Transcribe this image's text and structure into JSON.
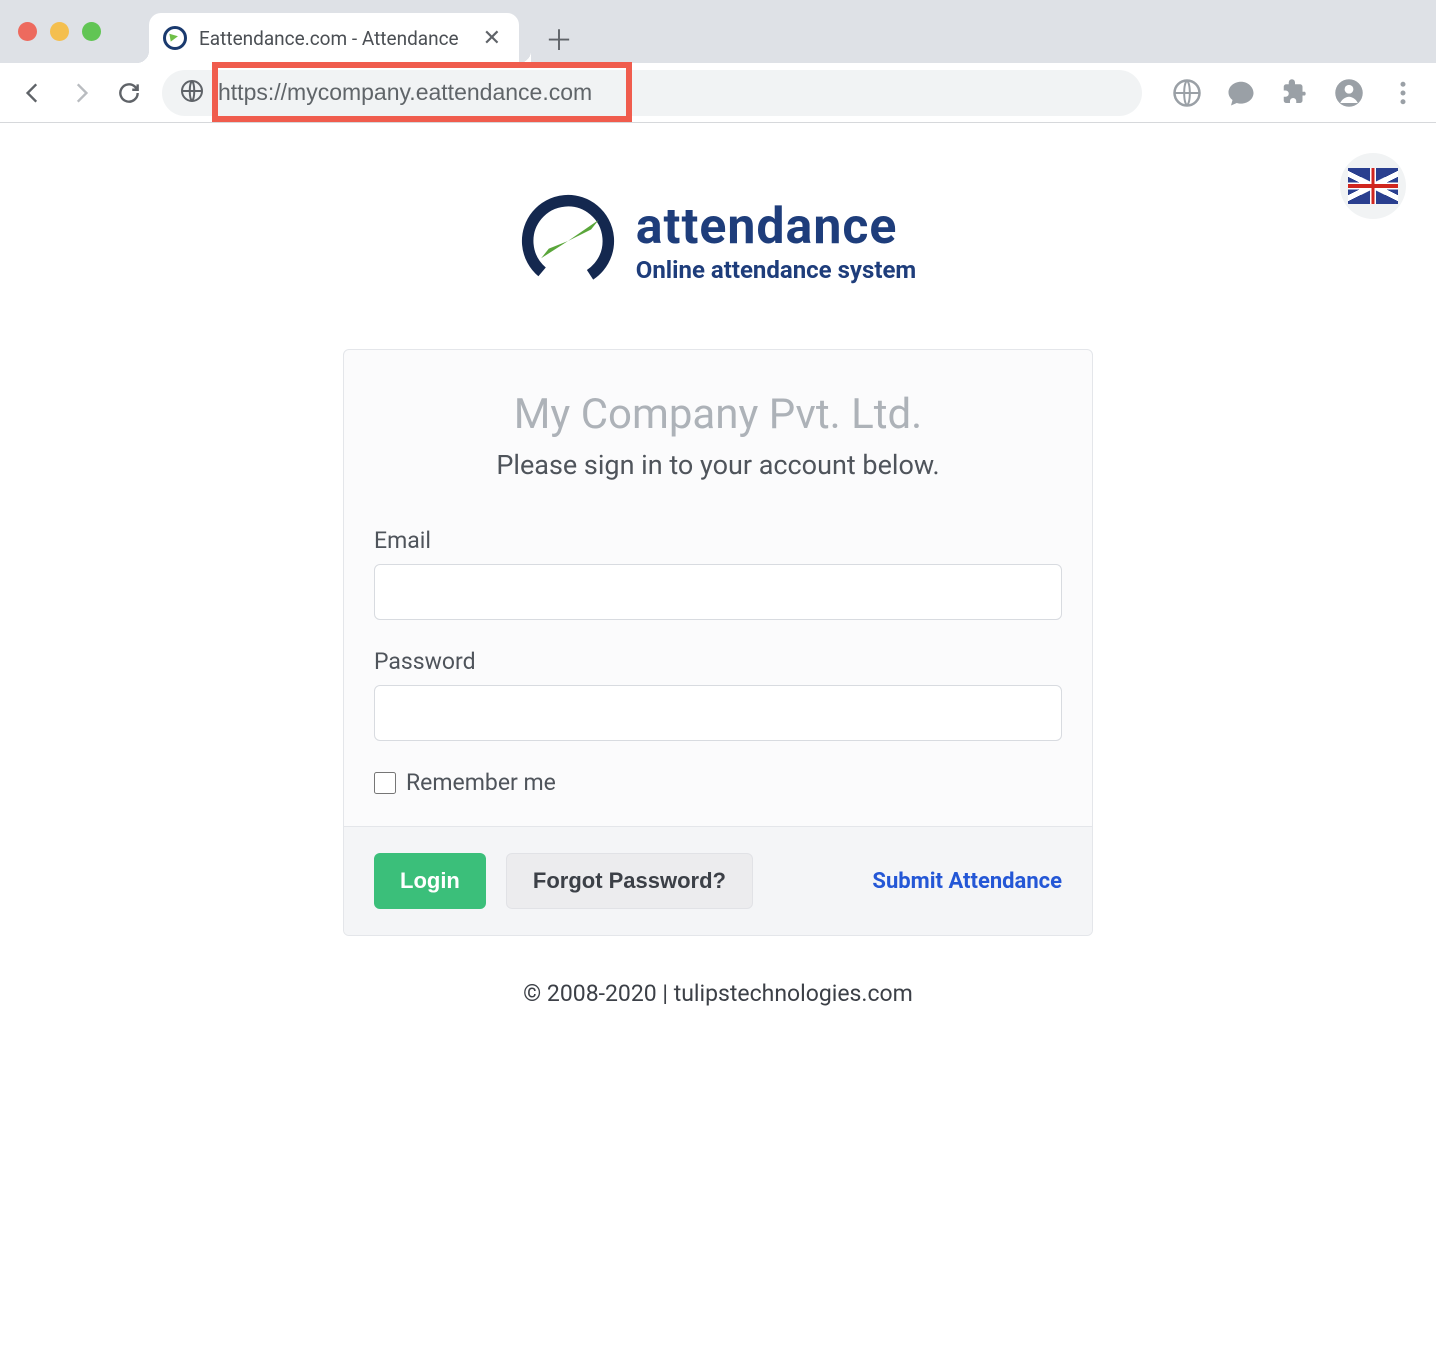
{
  "browser": {
    "tab_title": "Eattendance.com - Attendance",
    "url": "https://mycompany.eattendance.com"
  },
  "logo": {
    "line1": "attendance",
    "line2": "Online attendance system"
  },
  "login": {
    "company_name": "My Company Pvt. Ltd.",
    "subtitle": "Please sign in to your account below.",
    "email_label": "Email",
    "email_value": "",
    "password_label": "Password",
    "password_value": "",
    "remember_label": "Remember me",
    "login_button": "Login",
    "forgot_button": "Forgot Password?",
    "submit_link": "Submit Attendance"
  },
  "footer": "© 2008-2020 | tulipstechnologies.com"
}
